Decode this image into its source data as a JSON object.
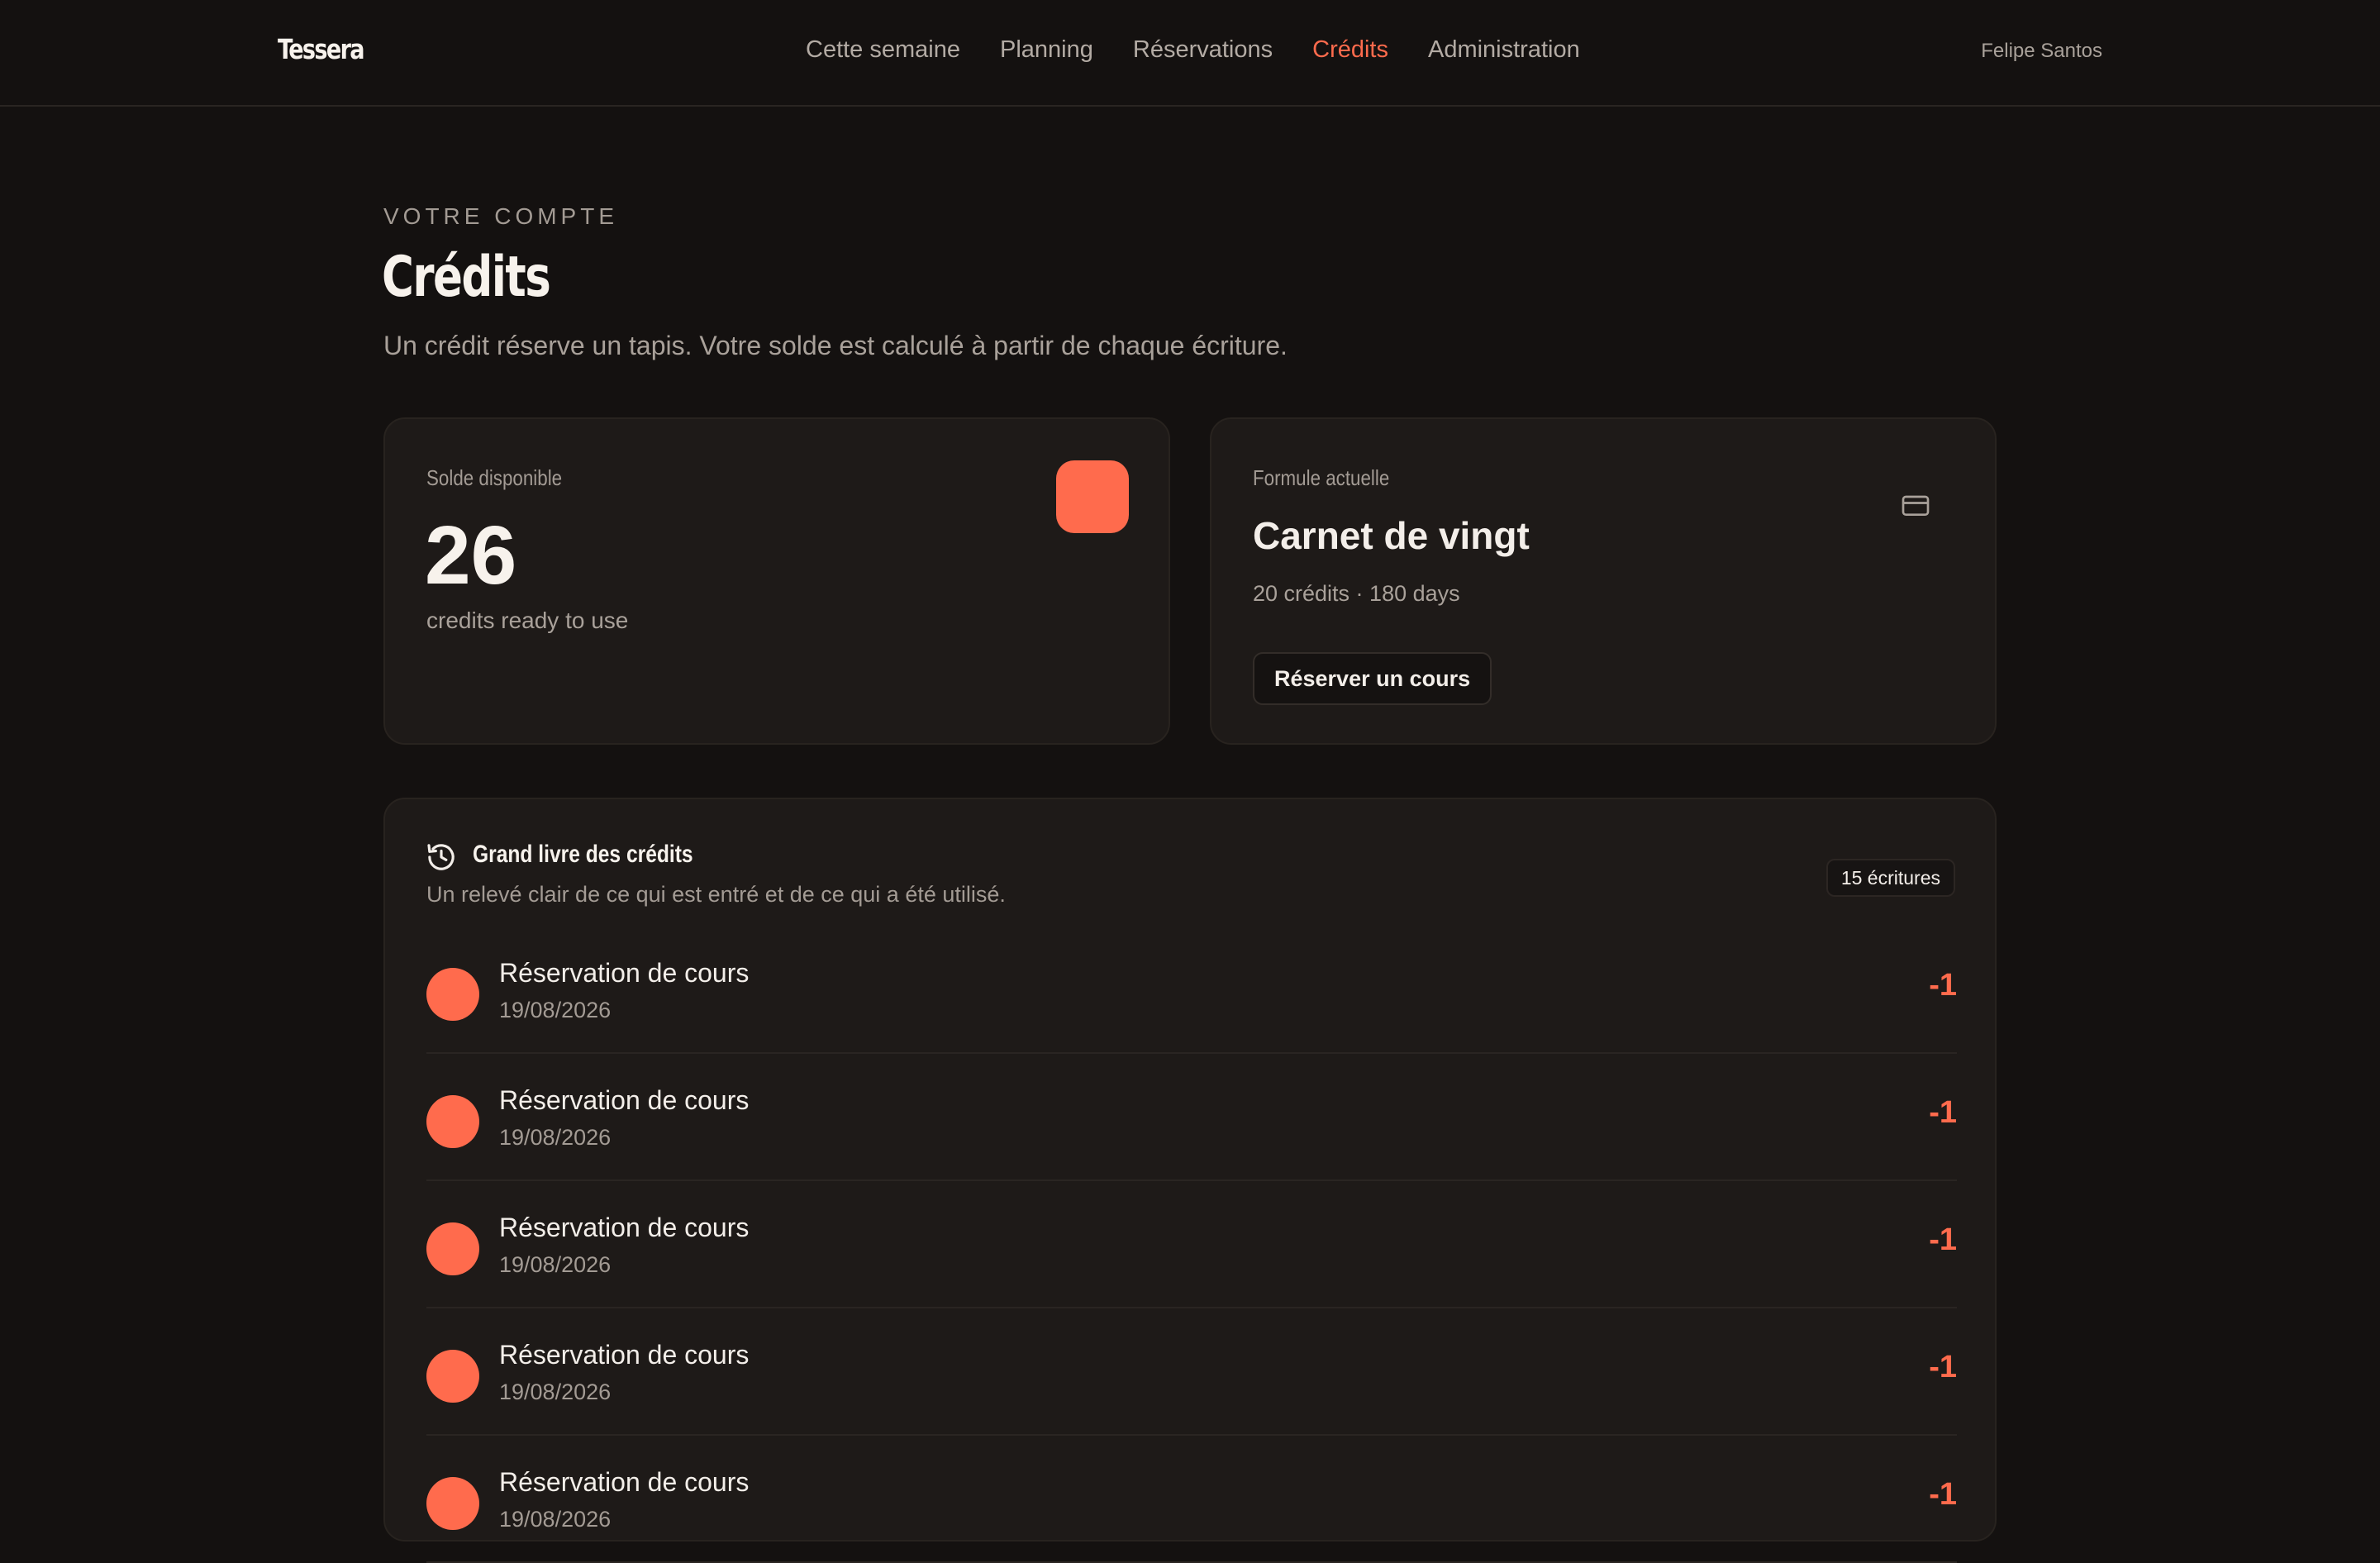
{
  "app": {
    "brand": "Tessera",
    "user_name": "Felipe Santos"
  },
  "nav": [
    {
      "label": "Cette semaine",
      "active": false
    },
    {
      "label": "Planning",
      "active": false
    },
    {
      "label": "Réservations",
      "active": false
    },
    {
      "label": "Crédits",
      "active": true
    },
    {
      "label": "Administration",
      "active": false
    }
  ],
  "page": {
    "eyebrow": "VOTRE COMPTE",
    "title": "Crédits",
    "subtitle": "Un crédit réserve un tapis. Votre solde est calculé à partir de chaque écriture."
  },
  "balance_card": {
    "label": "Solde disponible",
    "value": "26",
    "caption": "credits ready to use"
  },
  "plan_card": {
    "label": "Formule actuelle",
    "name": "Carnet de vingt",
    "details": "20 crédits · 180 days",
    "button_label": "Réserver un cours"
  },
  "ledger": {
    "title": "Grand livre des crédits",
    "subtitle": "Un relevé clair de ce qui est entré et de ce qui a été utilisé.",
    "count_label": "15 écritures",
    "entries": [
      {
        "title": "Réservation de cours",
        "date": "19/08/2026",
        "amount": "-1"
      },
      {
        "title": "Réservation de cours",
        "date": "19/08/2026",
        "amount": "-1"
      },
      {
        "title": "Réservation de cours",
        "date": "19/08/2026",
        "amount": "-1"
      },
      {
        "title": "Réservation de cours",
        "date": "19/08/2026",
        "amount": "-1"
      },
      {
        "title": "Réservation de cours",
        "date": "19/08/2026",
        "amount": "-1"
      }
    ]
  },
  "colors": {
    "accent": "#ff6b4d",
    "background": "#141110",
    "card": "#1e1a18"
  },
  "icons": {
    "plan": "credit-card-icon",
    "ledger": "history-icon"
  }
}
